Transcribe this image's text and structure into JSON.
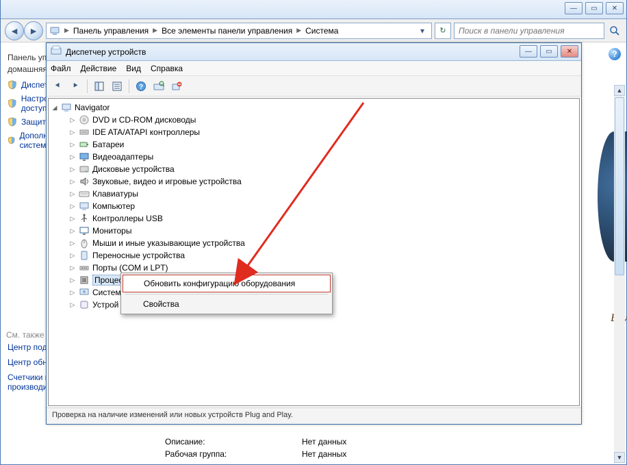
{
  "outer": {
    "breadcrumbs": [
      "Панель управления",
      "Все элементы панели управления",
      "Система"
    ],
    "search_placeholder": "Поиск в панели управления"
  },
  "leftnav": {
    "header1": "Панель управления —",
    "header2": "домашняя страница",
    "items": [
      "Диспетчер устройств",
      "Настройка удаленного доступа",
      "Защита системы",
      "Дополнительные параметры системы"
    ],
    "seealso": "См. также",
    "links": [
      "Центр поддержки",
      "Центр обновления Windows",
      "Счетчики и средства производительности"
    ]
  },
  "dm": {
    "title": "Диспетчер устройств",
    "menus": [
      "Файл",
      "Действие",
      "Вид",
      "Справка"
    ],
    "root": "Navigator",
    "nodes": [
      {
        "label": "DVD и CD-ROM дисководы",
        "icon": "disc"
      },
      {
        "label": "IDE ATA/ATAPI контроллеры",
        "icon": "ide"
      },
      {
        "label": "Батареи",
        "icon": "battery"
      },
      {
        "label": "Видеоадаптеры",
        "icon": "display"
      },
      {
        "label": "Дисковые устройства",
        "icon": "hdd"
      },
      {
        "label": "Звуковые, видео и игровые устройства",
        "icon": "sound"
      },
      {
        "label": "Клавиатуры",
        "icon": "keyboard"
      },
      {
        "label": "Компьютер",
        "icon": "computer"
      },
      {
        "label": "Контроллеры USB",
        "icon": "usb"
      },
      {
        "label": "Мониторы",
        "icon": "monitor"
      },
      {
        "label": "Мыши и иные указывающие устройства",
        "icon": "mouse"
      },
      {
        "label": "Переносные устройства",
        "icon": "portable"
      },
      {
        "label": "Порты (COM и LPT)",
        "icon": "port"
      },
      {
        "label": "Процессоры",
        "icon": "cpu",
        "selected": true
      },
      {
        "label": "Системные устройства",
        "icon": "system",
        "truncated": "Систем"
      },
      {
        "label": "Устройства HID",
        "icon": "hid",
        "truncated": "Устрой"
      }
    ],
    "status": "Проверка на наличие изменений или новых устройств Plug and Play."
  },
  "ctx": {
    "item1": "Обновить конфигурацию оборудования",
    "item2": "Свойства"
  },
  "props": {
    "k1": "Описание:",
    "v1": "Нет данных",
    "k2": "Рабочая группа:",
    "v2": "Нет данных"
  },
  "deco": "Bay"
}
